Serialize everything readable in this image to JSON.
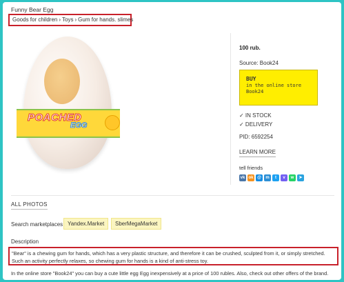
{
  "page": {
    "title": "Funny Bear Egg",
    "breadcrumb": [
      "Goods for children",
      "Toys",
      "Gum for hands. slimes"
    ],
    "breadcrumb_separator": "›"
  },
  "product_image": {
    "band_text": "POACHED",
    "band_subtext": "EGG"
  },
  "sidebar": {
    "price": "100 rub.",
    "source": "Source: Book24",
    "buy": {
      "title": "BUY",
      "line1": "in the online store",
      "line2": "Book24"
    },
    "in_stock": "✓ IN STOCK",
    "delivery": "✓ DELIVERY",
    "pid": "PID: 6592254",
    "learn_more": "LEARN MORE",
    "tell_friends": "tell friends",
    "socials": [
      {
        "name": "vk-icon",
        "glyph": "vk",
        "color": "#4a76a8"
      },
      {
        "name": "ok-icon",
        "glyph": "ok",
        "color": "#f7931e"
      },
      {
        "name": "mail-icon",
        "glyph": "@",
        "color": "#168de2"
      },
      {
        "name": "myworld-icon",
        "glyph": "m",
        "color": "#2d8fd5"
      },
      {
        "name": "twitter-icon",
        "glyph": "t",
        "color": "#1da1f2"
      },
      {
        "name": "viber-icon",
        "glyph": "v",
        "color": "#7360f2"
      },
      {
        "name": "whatsapp-icon",
        "glyph": "w",
        "color": "#25d366"
      },
      {
        "name": "telegram-icon",
        "glyph": "➤",
        "color": "#2aa3df"
      }
    ]
  },
  "main": {
    "all_photos": "ALL PHOTOS",
    "search_label": "Search marketplaces",
    "marketplaces": [
      "Yandex.Market",
      "SberMegaMarket"
    ],
    "description_label": "Description",
    "description": "\"Bear\" is a chewing gum for hands, which has a very plastic structure, and therefore it can be crushed, sculpted from it, or simply stretched. Such an activity perfectly relaxes, so chewing gum for hands is a kind of anti-stress toy.",
    "footer": "In the online store \"Book24\" you can buy a cute little egg Egg inexpensively at a price of 100 rubles. Also, check out other offers of the brand."
  },
  "colors": {
    "background": "#2ec4c4",
    "highlight_border": "#c8202a",
    "buy_button": "#ffee00",
    "marketplace_chip": "#fbf5c0"
  }
}
